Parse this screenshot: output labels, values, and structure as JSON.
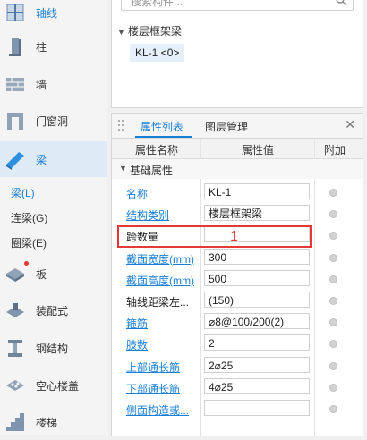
{
  "nav": {
    "items": [
      {
        "label": "轴线",
        "icon": "axis-icon"
      },
      {
        "label": "柱",
        "icon": "column-icon"
      },
      {
        "label": "墙",
        "icon": "wall-icon"
      },
      {
        "label": "门窗洞",
        "icon": "door-window-icon"
      },
      {
        "label": "梁",
        "icon": "beam-icon"
      }
    ],
    "beam_sub": [
      "梁(L)",
      "连梁(G)",
      "圈梁(E)"
    ],
    "items2": [
      {
        "label": "板",
        "icon": "slab-icon"
      },
      {
        "label": "装配式",
        "icon": "prefab-icon"
      },
      {
        "label": "钢结构",
        "icon": "steel-icon"
      },
      {
        "label": "空心楼盖",
        "icon": "hollow-floor-icon"
      },
      {
        "label": "楼梯",
        "icon": "stairs-icon"
      }
    ]
  },
  "search": {
    "placeholder": "搜索构件..."
  },
  "tree": {
    "group": "楼层框架梁",
    "leaf": "KL-1 <0>"
  },
  "panel": {
    "tab_props": "属性列表",
    "tab_layers": "图层管理",
    "header": {
      "name": "属性名称",
      "value": "属性值",
      "extra": "附加"
    },
    "group_label": "基础属性",
    "rows": [
      {
        "name": "名称",
        "value": "KL-1",
        "link": true
      },
      {
        "name": "结构类别",
        "value": "楼层框架梁",
        "link": true
      },
      {
        "name": "跨数量",
        "value": "",
        "link": false
      },
      {
        "name": "截面宽度(mm)",
        "value": "300",
        "link": true
      },
      {
        "name": "截面高度(mm)",
        "value": "500",
        "link": true
      },
      {
        "name": "轴线距梁左...",
        "value": "(150)",
        "link": false
      },
      {
        "name": "箍筋",
        "value": "⌀8@100/200(2)",
        "link": true
      },
      {
        "name": "肢数",
        "value": "2",
        "link": true
      },
      {
        "name": "上部通长筋",
        "value": "2⌀25",
        "link": true
      },
      {
        "name": "下部通长筋",
        "value": "4⌀25",
        "link": true
      },
      {
        "name": "侧面构造或...",
        "value": "",
        "link": true
      }
    ],
    "annotation": "1"
  },
  "colors": {
    "accent": "#1a7fd6",
    "annotation": "#e53935"
  }
}
